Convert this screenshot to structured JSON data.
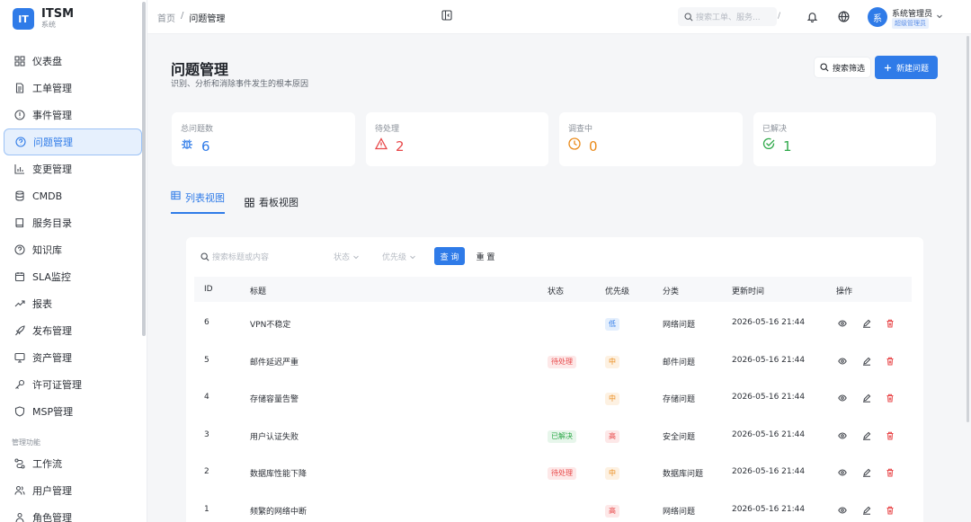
{
  "app": {
    "logo_badge": "IT",
    "title": "ITSM",
    "subtitle": "系统"
  },
  "sidebar": {
    "items": [
      {
        "label": "仪表盘",
        "icon": "dashboard-icon"
      },
      {
        "label": "工单管理",
        "icon": "document-icon"
      },
      {
        "label": "事件管理",
        "icon": "alert-circle-icon"
      },
      {
        "label": "问题管理",
        "icon": "question-circle-icon",
        "active": true
      },
      {
        "label": "变更管理",
        "icon": "bar-chart-icon"
      },
      {
        "label": "CMDB",
        "icon": "database-icon"
      },
      {
        "label": "服务目录",
        "icon": "book-icon"
      },
      {
        "label": "知识库",
        "icon": "question-circle-icon"
      },
      {
        "label": "SLA监控",
        "icon": "calendar-icon"
      },
      {
        "label": "报表",
        "icon": "trend-icon"
      },
      {
        "label": "发布管理",
        "icon": "rocket-icon"
      },
      {
        "label": "资产管理",
        "icon": "monitor-icon"
      },
      {
        "label": "许可证管理",
        "icon": "key-icon"
      },
      {
        "label": "MSP管理",
        "icon": "shield-icon"
      }
    ],
    "section_label": "管理功能",
    "admin_items": [
      {
        "label": "工作流",
        "icon": "workflow-icon"
      },
      {
        "label": "用户管理",
        "icon": "users-icon"
      },
      {
        "label": "角色管理",
        "icon": "role-icon"
      }
    ]
  },
  "topbar": {
    "breadcrumb": [
      "首页",
      "问题管理"
    ],
    "search_placeholder": "搜索工单、服务...",
    "search_shortcut": "/",
    "user_avatar": "系",
    "user_name": "系统管理员",
    "user_role": "超级管理员"
  },
  "page": {
    "title": "问题管理",
    "subtitle": "识别、分析和消除事件发生的根本原因",
    "filter_button": "搜索筛选",
    "new_button": "新建问题"
  },
  "stats": [
    {
      "label": "总问题数",
      "value": "6",
      "icon": "bug-icon",
      "color": "#2f7be8"
    },
    {
      "label": "待处理",
      "value": "2",
      "icon": "warning-icon",
      "color": "#e84749"
    },
    {
      "label": "调查中",
      "value": "0",
      "icon": "clock-icon",
      "color": "#ea8a1a"
    },
    {
      "label": "已解决",
      "value": "1",
      "icon": "check-circle-icon",
      "color": "#2fa94a"
    }
  ],
  "views": {
    "list": "列表视图",
    "board": "看板视图"
  },
  "filters": {
    "search_placeholder": "搜索标题或内容",
    "status_placeholder": "状态",
    "priority_placeholder": "优先级",
    "query_button": "查 询",
    "reset_button": "重 置"
  },
  "table": {
    "headers": [
      "ID",
      "标题",
      "状态",
      "优先级",
      "分类",
      "更新时间",
      "操作"
    ],
    "rows": [
      {
        "id": "6",
        "title": "VPN不稳定",
        "status": "",
        "priority": "低",
        "category": "网络问题",
        "updated": "2026-05-16 21:44"
      },
      {
        "id": "5",
        "title": "邮件延迟严重",
        "status": "待处理",
        "priority": "中",
        "category": "邮件问题",
        "updated": "2026-05-16 21:44"
      },
      {
        "id": "4",
        "title": "存储容量告警",
        "status": "",
        "priority": "中",
        "category": "存储问题",
        "updated": "2026-05-16 21:44"
      },
      {
        "id": "3",
        "title": "用户认证失败",
        "status": "已解决",
        "priority": "高",
        "category": "安全问题",
        "updated": "2026-05-16 21:44"
      },
      {
        "id": "2",
        "title": "数据库性能下降",
        "status": "待处理",
        "priority": "中",
        "category": "数据库问题",
        "updated": "2026-05-16 21:44"
      },
      {
        "id": "1",
        "title": "频繁的网络中断",
        "status": "",
        "priority": "高",
        "category": "网络问题",
        "updated": "2026-05-16 21:44"
      }
    ]
  }
}
